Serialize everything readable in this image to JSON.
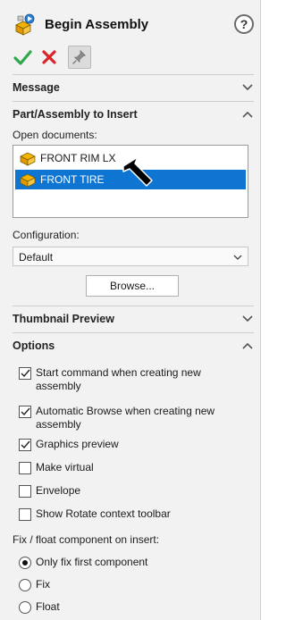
{
  "header": {
    "title": "Begin Assembly",
    "help_glyph": "?",
    "icon": "begin-assembly-icon"
  },
  "actions": {
    "ok": "check-icon",
    "cancel": "cross-icon",
    "pin": "pushpin-icon"
  },
  "sections": {
    "message": {
      "title": "Message",
      "expanded": false
    },
    "insert": {
      "title": "Part/Assembly to Insert",
      "expanded": true
    },
    "thumbnail": {
      "title": "Thumbnail Preview",
      "expanded": false
    },
    "options": {
      "title": "Options",
      "expanded": true
    }
  },
  "insert": {
    "open_documents_label": "Open documents:",
    "documents": [
      {
        "name": "FRONT RIM LX",
        "selected": false
      },
      {
        "name": "FRONT TIRE",
        "selected": true
      }
    ],
    "configuration_label": "Configuration:",
    "configuration_value": "Default",
    "browse_label": "Browse..."
  },
  "options": {
    "checkboxes": [
      {
        "label": "Start command when creating new assembly",
        "checked": true
      },
      {
        "label": "Automatic Browse when creating new assembly",
        "checked": true
      },
      {
        "label": "Graphics preview",
        "checked": true
      },
      {
        "label": "Make virtual",
        "checked": false
      },
      {
        "label": "Envelope",
        "checked": false
      },
      {
        "label": "Show Rotate context toolbar",
        "checked": false
      }
    ],
    "fix_float_label": "Fix / float component on insert:",
    "radios": [
      {
        "label": "Only fix first component",
        "selected": true
      },
      {
        "label": "Fix",
        "selected": false
      },
      {
        "label": "Float",
        "selected": false
      }
    ]
  },
  "colors": {
    "selection": "#0e75d2",
    "ok_green": "#2ea84a",
    "cancel_red": "#d9252a",
    "doc_icon_yellow": "#f5b400"
  }
}
